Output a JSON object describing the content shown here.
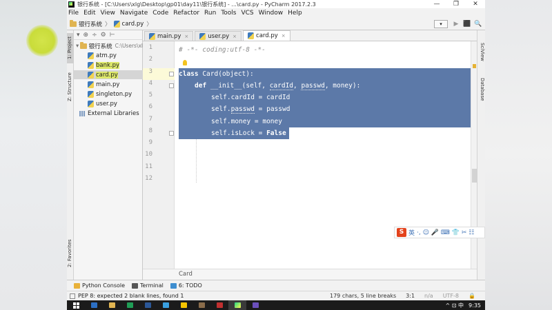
{
  "window": {
    "title": "银行系统 - [C:\\Users\\xlg\\Desktop\\gp01\\day11\\银行系统] - ...\\card.py - PyCharm 2017.2.3",
    "min": "—",
    "max": "❐",
    "close": "✕"
  },
  "menu": [
    "File",
    "Edit",
    "View",
    "Navigate",
    "Code",
    "Refactor",
    "Run",
    "Tools",
    "VCS",
    "Window",
    "Help"
  ],
  "breadcrumb": {
    "project": "银行系统",
    "file": "card.py"
  },
  "nav_icons": {
    "dropdown": "▾",
    "run": "▶",
    "debug": "⬛",
    "search": "🔍"
  },
  "left_tabs": {
    "project": "1: Project",
    "structure": "Z: Structure",
    "favorites": "2: Favorites"
  },
  "right_tabs": {
    "sciview": "SciView",
    "database": "Database"
  },
  "project_toolbar": [
    "▾",
    "⊕",
    "÷",
    "⚙",
    "⊢"
  ],
  "project_tree": {
    "root": "银行系统",
    "root_path": "C:\\Users\\xl",
    "files": [
      "atm.py",
      "bank.py",
      "card.py",
      "main.py",
      "singleton.py",
      "user.py"
    ],
    "libs": "External Libraries"
  },
  "tabs": [
    {
      "label": "main.py",
      "close": "×"
    },
    {
      "label": "user.py",
      "close": "×"
    },
    {
      "label": "card.py",
      "close": "×"
    }
  ],
  "line_numbers": [
    "1",
    "2",
    "3",
    "4",
    "5",
    "6",
    "7",
    "8",
    "9",
    "10",
    "11",
    "12"
  ],
  "code": {
    "l1": "# -*- coding:utf-8 -*-",
    "l3_kw": "class ",
    "l3_name": "Card",
    "l3_rest": "(object):",
    "l4_kw": "def ",
    "l4_name": "__init__",
    "l4_a": "(self, ",
    "l4_b": "cardId",
    "l4_c": ", ",
    "l4_d": "passwd",
    "l4_e": ", money):",
    "l5": "self.cardId = cardId",
    "l6_a": "self.",
    "l6_b": "passwd",
    "l6_c": " = passwd",
    "l7": "self.money = money",
    "l8_a": "self.isLock = ",
    "l8_b": "False"
  },
  "editor_breadcrumb": "Card",
  "ime": {
    "logo": "S",
    "lang": "英",
    "icons": "·, ☺ 🎤 ⌨ 👕 ✂ ☷"
  },
  "bottom_tabs": [
    {
      "label": "Python Console",
      "color": "#e8b13a"
    },
    {
      "label": "Terminal",
      "color": "#555555"
    },
    {
      "label": "6: TODO",
      "color": "#3e8ed0"
    }
  ],
  "status": {
    "message": "PEP 8: expected 2 blank lines, found 1",
    "chars": "179 chars, 5 line breaks",
    "pos": "3:1",
    "crlf": "n/a",
    "enc": "UTF-8",
    "lock": "🔒"
  },
  "taskbar": {
    "time": "9:35",
    "tray": "^ ⊡ 中"
  }
}
